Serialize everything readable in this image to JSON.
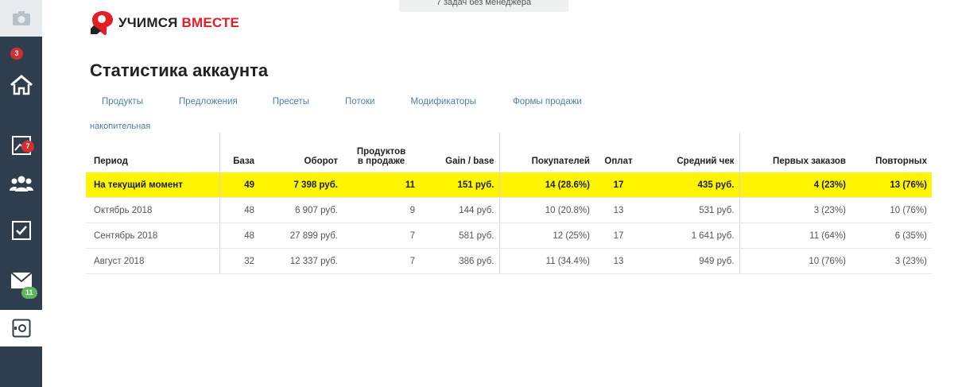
{
  "notice": "7 задач без менеджера",
  "logo": {
    "word1": "УЧИМСЯ",
    "word2": "ВМЕСТЕ"
  },
  "title": "Статистика аккаунта",
  "tabs": [
    "Продукты",
    "Предложения",
    "Пресеты",
    "Потоки",
    "Модификаторы",
    "Формы продажи"
  ],
  "cumulative": "накопительная",
  "sidebar": {
    "items": [
      {
        "icon": "camera-icon"
      },
      {
        "icon": "home-icon",
        "badge": "3"
      },
      {
        "icon": "chart-icon",
        "badge": "7"
      },
      {
        "icon": "users-icon"
      },
      {
        "icon": "checkbox-icon"
      },
      {
        "icon": "mail-icon",
        "badge": "11"
      },
      {
        "icon": "safe-icon",
        "active": true
      }
    ]
  },
  "table": {
    "headers": {
      "period": "Период",
      "base": "База",
      "turnover": "Оборот",
      "products_line1": "Продуктов",
      "products_line2": "в продаже",
      "gain": "Gain / base",
      "buyers": "Покупателей",
      "payments": "Оплат",
      "avg_check": "Средний чек",
      "first_orders": "Первых заказов",
      "repeat": "Повторных"
    },
    "rows": [
      {
        "period": "На текущий момент",
        "base": "49",
        "turnover": "7 398 руб.",
        "products": "11",
        "gain": "151 руб.",
        "buyers": "14 (28.6%)",
        "payments": "17",
        "avg_check": "435 руб.",
        "first_orders": "4 (23%)",
        "repeat": "13 (76%)"
      },
      {
        "period": "Октябрь 2018",
        "base": "48",
        "turnover": "6 907 руб.",
        "products": "9",
        "gain": "144 руб.",
        "buyers": "10 (20.8%)",
        "payments": "13",
        "avg_check": "531 руб.",
        "first_orders": "3 (23%)",
        "repeat": "10 (76%)"
      },
      {
        "period": "Сентябрь 2018",
        "base": "48",
        "turnover": "27 899 руб.",
        "products": "7",
        "gain": "581 руб.",
        "buyers": "12 (25%)",
        "payments": "17",
        "avg_check": "1 641 руб.",
        "first_orders": "11 (64%)",
        "repeat": "6 (35%)"
      },
      {
        "period": "Август 2018",
        "base": "32",
        "turnover": "12 337 руб.",
        "products": "7",
        "gain": "386 руб.",
        "buyers": "11 (34.4%)",
        "payments": "13",
        "avg_check": "949 руб.",
        "first_orders": "10 (76%)",
        "repeat": "3 (23%)"
      }
    ]
  },
  "colors": {
    "sidebar": "#2f3e4e",
    "highlight": "#fff500",
    "link": "#4a7fb5",
    "brand_red": "#e31e24"
  }
}
